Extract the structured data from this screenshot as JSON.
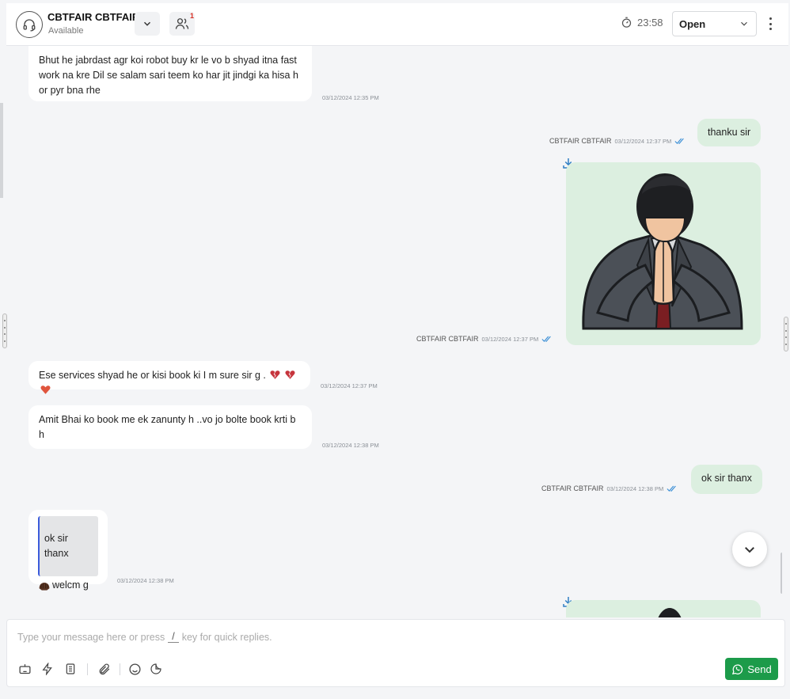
{
  "header": {
    "agent_name": "CBTFAIR CBTFAIR",
    "agent_status": "Available",
    "contacts_badge": "1",
    "timer": "23:58",
    "conversation_status": "Open"
  },
  "messages": {
    "m1": {
      "text": "Bhut he jabrdast agr koi robot buy kr le vo b shyad itna fast work na kre Dil se salam sari teem ko har jit jindgi ka hisa h or pyr bna rhe",
      "time": "03/12/2024 12:35 PM"
    },
    "m2": {
      "text": "thanku sir",
      "sender": "CBTFAIR CBTFAIR",
      "time": "03/12/2024 12:37 PM"
    },
    "m3": {
      "sender": "CBTFAIR CBTFAIR",
      "time": "03/12/2024 12:37 PM"
    },
    "m4": {
      "text": "Ese services shyad he or kisi book ki I m sure sir g .",
      "time": "03/12/2024 12:37 PM"
    },
    "m5": {
      "text": "Amit Bhai ko book me ek zanunty h ..vo jo bolte book krti b h",
      "time": "03/12/2024 12:38 PM"
    },
    "m6": {
      "text": "ok sir thanx",
      "sender": "CBTFAIR CBTFAIR",
      "time": "03/12/2024 12:38 PM"
    },
    "m7": {
      "quoted": "ok sir thanx",
      "text": "welcm g",
      "time": "03/12/2024 12:38 PM"
    }
  },
  "composer": {
    "placeholder_before": "Type your message here or press",
    "slash_key": "/",
    "placeholder_after": "key for quick replies.",
    "send_label": "Send"
  },
  "colors": {
    "outgoing_bubble": "#dcefe0",
    "send_button": "#1c9b4a",
    "badge": "#d93025",
    "read_ticks": "#3b8fd6"
  }
}
